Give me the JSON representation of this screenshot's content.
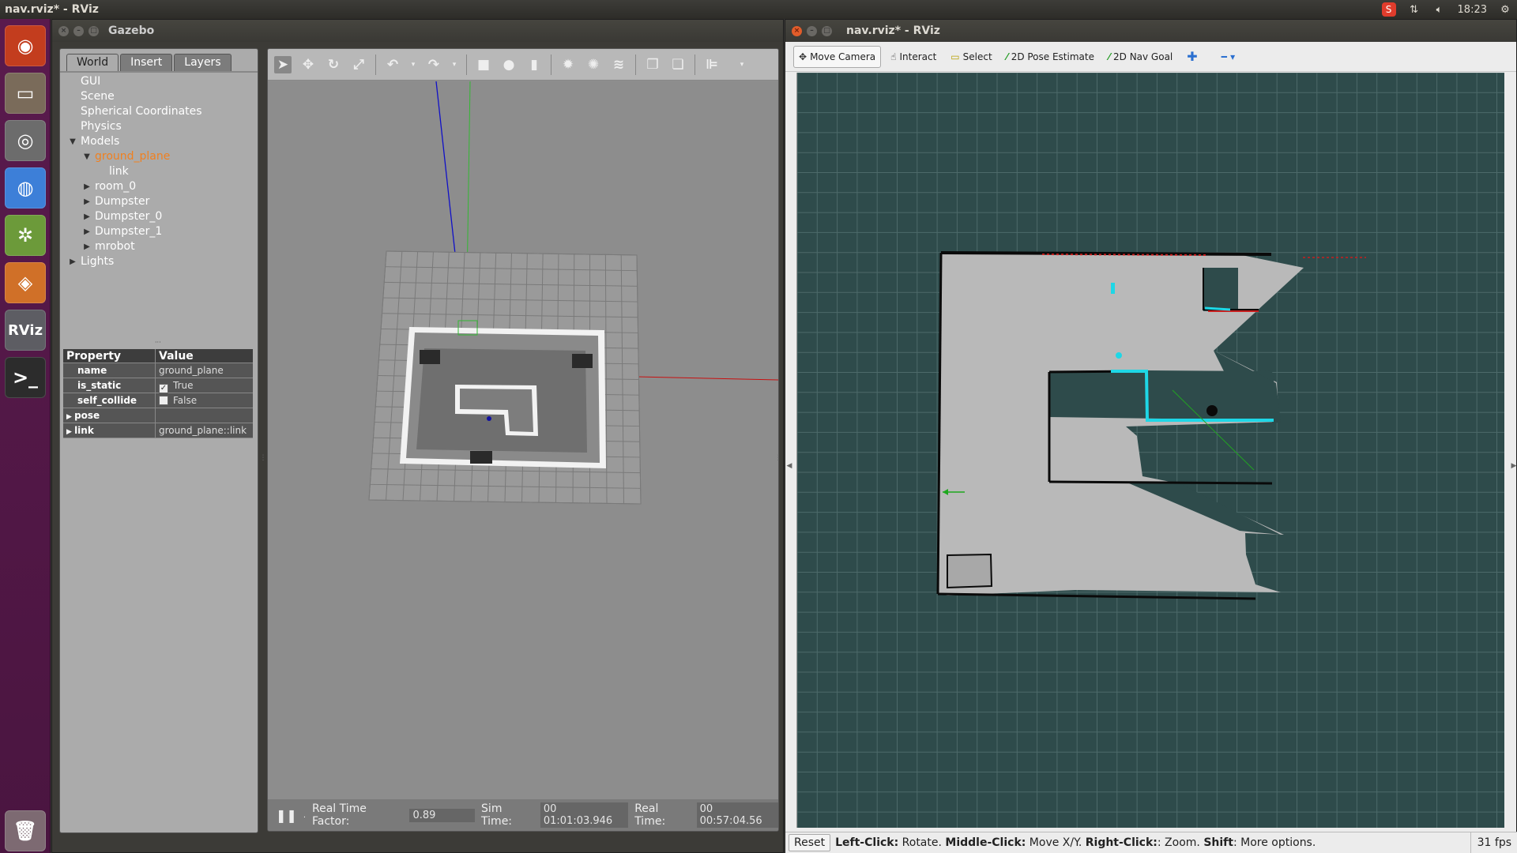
{
  "topbar": {
    "title": "nav.rviz* - RViz",
    "time": "18:23"
  },
  "launcher": [
    {
      "name": "ubuntu-dash",
      "label": "◉",
      "color": "#c33d1e"
    },
    {
      "name": "files",
      "label": "▭",
      "color": "#7a6b5a"
    },
    {
      "name": "camera",
      "label": "◎",
      "color": "#6c6c6c"
    },
    {
      "name": "chrome",
      "label": "◍",
      "color": "#3d7fd8"
    },
    {
      "name": "network-app",
      "label": "✲",
      "color": "#6c9a3a"
    },
    {
      "name": "box-app",
      "label": "◈",
      "color": "#d07028"
    },
    {
      "name": "rviz",
      "label": "RViz",
      "color": "#5d5d63"
    },
    {
      "name": "terminal",
      "label": ">_",
      "color": "#2c2c2c"
    }
  ],
  "gazebo": {
    "title": "Gazebo",
    "tabs": [
      "World",
      "Insert",
      "Layers"
    ],
    "tree": [
      {
        "label": "GUI",
        "indent": 0,
        "arrow": ""
      },
      {
        "label": "Scene",
        "indent": 0,
        "arrow": ""
      },
      {
        "label": "Spherical Coordinates",
        "indent": 0,
        "arrow": ""
      },
      {
        "label": "Physics",
        "indent": 0,
        "arrow": ""
      },
      {
        "label": "Models",
        "indent": 0,
        "arrow": "down"
      },
      {
        "label": "ground_plane",
        "indent": 1,
        "arrow": "down",
        "selected": true
      },
      {
        "label": "link",
        "indent": 2,
        "arrow": ""
      },
      {
        "label": "room_0",
        "indent": 1,
        "arrow": "right"
      },
      {
        "label": "Dumpster",
        "indent": 1,
        "arrow": "right"
      },
      {
        "label": "Dumpster_0",
        "indent": 1,
        "arrow": "right"
      },
      {
        "label": "Dumpster_1",
        "indent": 1,
        "arrow": "right"
      },
      {
        "label": "mrobot",
        "indent": 1,
        "arrow": "right"
      },
      {
        "label": "Lights",
        "indent": 0,
        "arrow": "right"
      }
    ],
    "props": {
      "head": [
        "Property",
        "Value"
      ],
      "rows": [
        {
          "k": "name",
          "v": "ground_plane",
          "type": "text"
        },
        {
          "k": "is_static",
          "v": "True",
          "type": "check",
          "checked": true
        },
        {
          "k": "self_collide",
          "v": "False",
          "type": "check",
          "checked": false
        },
        {
          "k": "pose",
          "v": "",
          "type": "expand"
        },
        {
          "k": "link",
          "v": "ground_plane::link",
          "type": "expand"
        }
      ]
    },
    "status": {
      "rtf_label": "Real Time Factor:",
      "rtf": "0.89",
      "sim_label": "Sim Time:",
      "sim": "00 01:01:03.946",
      "real_label": "Real Time:",
      "real": "00 00:57:04.56"
    }
  },
  "rviz": {
    "title": "nav.rviz* - RViz",
    "tools": [
      {
        "name": "move-camera-button",
        "label": "Move Camera",
        "icon": "✥",
        "active": true
      },
      {
        "name": "interact-button",
        "label": "Interact",
        "icon": "☝",
        "active": false
      },
      {
        "name": "select-button",
        "label": "Select",
        "icon": "▭",
        "active": false
      },
      {
        "name": "pose-estimate-button",
        "label": "2D Pose Estimate",
        "icon": "⁄",
        "active": false
      },
      {
        "name": "nav-goal-button",
        "label": "2D Nav Goal",
        "icon": "⁄",
        "active": false
      }
    ],
    "status": {
      "reset": "Reset",
      "help": [
        {
          "b": "Left-Click:",
          "t": " Rotate. "
        },
        {
          "b": "Middle-Click:",
          "t": " Move X/Y. "
        },
        {
          "b": "Right-Click:",
          "t": ": Zoom. "
        },
        {
          "b": "Shift",
          "t": ": More options."
        }
      ],
      "fps": "31 fps"
    }
  }
}
